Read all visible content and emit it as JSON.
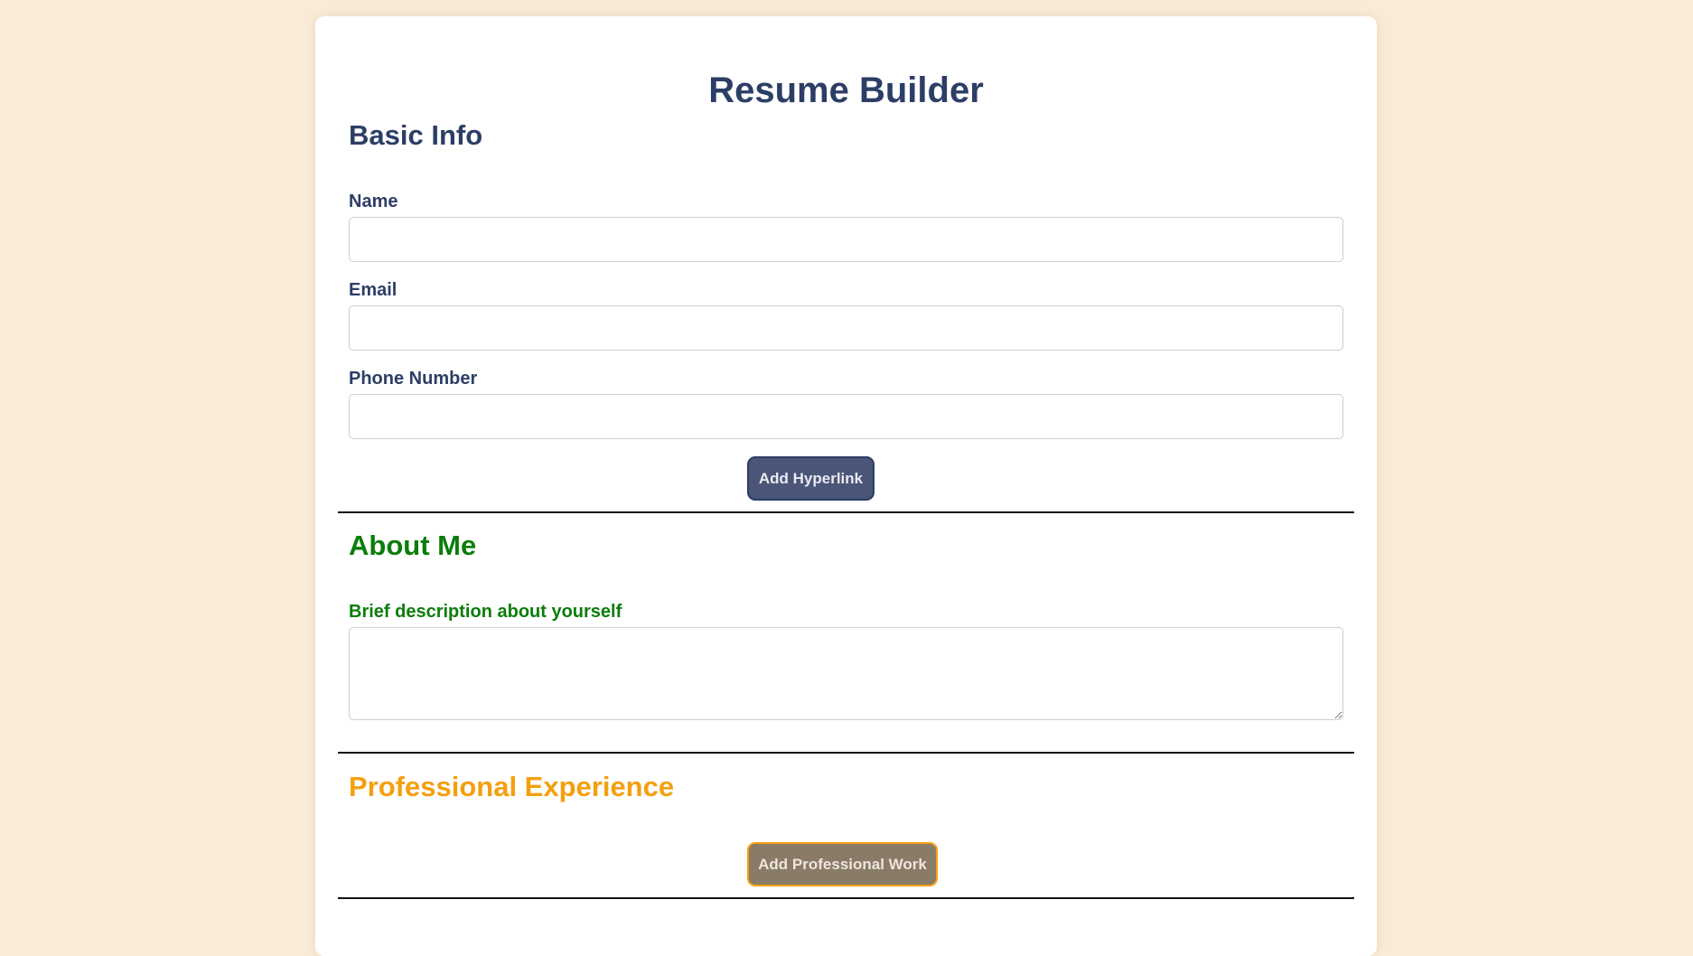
{
  "page": {
    "title": "Resume Builder"
  },
  "basic_info": {
    "heading": "Basic Info",
    "name_label": "Name",
    "name_value": "",
    "email_label": "Email",
    "email_value": "",
    "phone_label": "Phone Number",
    "phone_value": "",
    "add_hyperlink_label": "Add Hyperlink"
  },
  "about_me": {
    "heading": "About Me",
    "description_label": "Brief description about yourself",
    "description_value": ""
  },
  "professional_experience": {
    "heading": "Professional Experience",
    "add_work_label": "Add Professional Work"
  },
  "colors": {
    "background": "#faebd7",
    "basic_info": "#2c3e66",
    "about_me": "#0a7d0a",
    "professional_experience": "#f59f0e"
  }
}
